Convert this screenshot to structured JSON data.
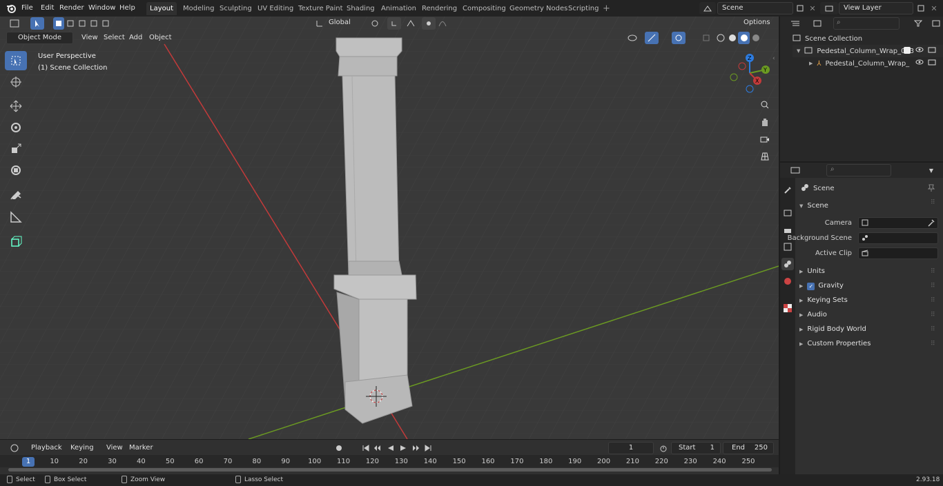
{
  "topbar": {
    "menus": [
      "File",
      "Edit",
      "Render",
      "Window",
      "Help"
    ],
    "workspaces": [
      "Layout",
      "Modeling",
      "Sculpting",
      "UV Editing",
      "Texture Paint",
      "Shading",
      "Animation",
      "Rendering",
      "Compositing",
      "Geometry Nodes",
      "Scripting"
    ],
    "active_workspace": "Layout",
    "scene_name": "Scene",
    "view_layer": "View Layer"
  },
  "viewport": {
    "mode": "Object Mode",
    "menus": [
      "View",
      "Select",
      "Add",
      "Object"
    ],
    "transform_orientation": "Global",
    "options_label": "Options",
    "overlay_line1": "User Perspective",
    "overlay_line2": "(1) Scene Collection",
    "gizmo_axes": {
      "z": "Z",
      "y": "Y",
      "x": "X"
    },
    "colors": {
      "x_axis": "#c33a3a",
      "y_axis": "#6b9a22",
      "z_axis": "#2d7ce0",
      "background": "#393939"
    }
  },
  "outliner": {
    "root": "Scene Collection",
    "items": [
      {
        "label": "Pedestal_Column_Wrap_003",
        "depth": 1
      },
      {
        "label": "Pedestal_Column_Wrap_",
        "depth": 2
      }
    ]
  },
  "properties": {
    "context": "Scene",
    "section": "Scene",
    "fields": [
      {
        "label": "Camera"
      },
      {
        "label": "Background Scene"
      },
      {
        "label": "Active Clip"
      }
    ],
    "panels": [
      "Units",
      "Gravity",
      "Keying Sets",
      "Audio",
      "Rigid Body World",
      "Custom Properties"
    ]
  },
  "timeline": {
    "menus": [
      "Playback",
      "Keying",
      "View",
      "Marker"
    ],
    "current_frame": "1",
    "start_label": "Start",
    "start_value": "1",
    "end_label": "End",
    "end_value": "250",
    "ticks": [
      "1",
      "10",
      "20",
      "30",
      "40",
      "50",
      "60",
      "70",
      "80",
      "90",
      "100",
      "110",
      "120",
      "130",
      "140",
      "150",
      "160",
      "170",
      "180",
      "190",
      "200",
      "210",
      "220",
      "230",
      "240",
      "250"
    ]
  },
  "statusbar": {
    "select": "Select",
    "box_select": "Box Select",
    "zoom_view": "Zoom View",
    "lasso_select": "Lasso Select",
    "version": "2.93.18"
  }
}
